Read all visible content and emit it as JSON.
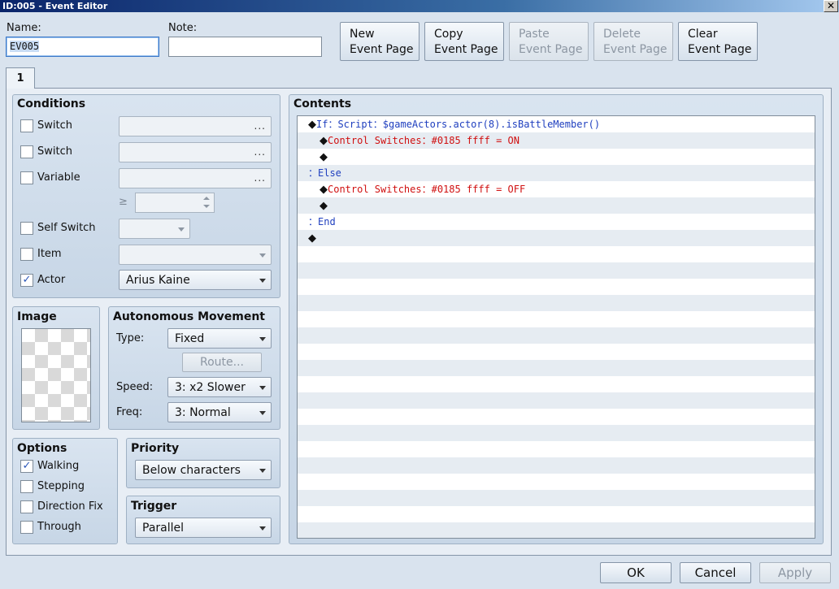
{
  "window": {
    "title": "ID:005 - Event Editor",
    "close_glyph": "✕"
  },
  "header": {
    "name_label": "Name:",
    "name_value": "EV005",
    "note_label": "Note:",
    "note_value": "",
    "buttons": [
      {
        "line1": "New",
        "line2": "Event Page",
        "enabled": true
      },
      {
        "line1": "Copy",
        "line2": "Event Page",
        "enabled": true
      },
      {
        "line1": "Paste",
        "line2": "Event Page",
        "enabled": false
      },
      {
        "line1": "Delete",
        "line2": "Event Page",
        "enabled": false
      },
      {
        "line1": "Clear",
        "line2": "Event Page",
        "enabled": true
      }
    ]
  },
  "tabs": [
    {
      "label": "1",
      "active": true
    }
  ],
  "conditions": {
    "title": "Conditions",
    "switch1": {
      "label": "Switch",
      "checked": false,
      "value": "",
      "dots": "..."
    },
    "switch2": {
      "label": "Switch",
      "checked": false,
      "value": "",
      "dots": "..."
    },
    "variable": {
      "label": "Variable",
      "checked": false,
      "value": "",
      "dots": "...",
      "operator": "≥",
      "amount": ""
    },
    "self_switch": {
      "label": "Self Switch",
      "checked": false,
      "value": ""
    },
    "item": {
      "label": "Item",
      "checked": false,
      "value": ""
    },
    "actor": {
      "label": "Actor",
      "checked": true,
      "value": "Arius Kaine"
    },
    "check_glyph": "✓"
  },
  "image": {
    "title": "Image"
  },
  "autonomous_movement": {
    "title": "Autonomous Movement",
    "type_label": "Type:",
    "type_value": "Fixed",
    "route_label": "Route...",
    "speed_label": "Speed:",
    "speed_value": "3: x2 Slower",
    "freq_label": "Freq:",
    "freq_value": "3: Normal"
  },
  "options": {
    "title": "Options",
    "walking": {
      "label": "Walking",
      "checked": true
    },
    "stepping": {
      "label": "Stepping",
      "checked": false
    },
    "direction_fix": {
      "label": "Direction Fix",
      "checked": false
    },
    "through": {
      "label": "Through",
      "checked": false
    }
  },
  "priority": {
    "title": "Priority",
    "value": "Below characters"
  },
  "trigger": {
    "title": "Trigger",
    "value": "Parallel"
  },
  "contents": {
    "title": "Contents",
    "commands": [
      {
        "indent": 0,
        "diamond": "◆",
        "parts": [
          {
            "text": "If：Script：$gameActors.actor(8).isBattleMember()",
            "color": "blue"
          }
        ]
      },
      {
        "indent": 1,
        "diamond": "◆",
        "parts": [
          {
            "text": "Control Switches：#0185 ffff = ON",
            "color": "red"
          }
        ]
      },
      {
        "indent": 1,
        "diamond": "◆",
        "parts": []
      },
      {
        "indent": 0,
        "diamond": "",
        "parts": [
          {
            "text": "：Else",
            "color": "blue"
          }
        ]
      },
      {
        "indent": 1,
        "diamond": "◆",
        "parts": [
          {
            "text": "Control Switches：#0185 ffff = OFF",
            "color": "red"
          }
        ]
      },
      {
        "indent": 1,
        "diamond": "◆",
        "parts": []
      },
      {
        "indent": 0,
        "diamond": "",
        "parts": [
          {
            "text": "：End",
            "color": "blue"
          }
        ]
      },
      {
        "indent": 0,
        "diamond": "◆",
        "parts": []
      }
    ]
  },
  "footer": {
    "ok_label": "OK",
    "cancel_label": "Cancel",
    "apply_label": "Apply"
  }
}
